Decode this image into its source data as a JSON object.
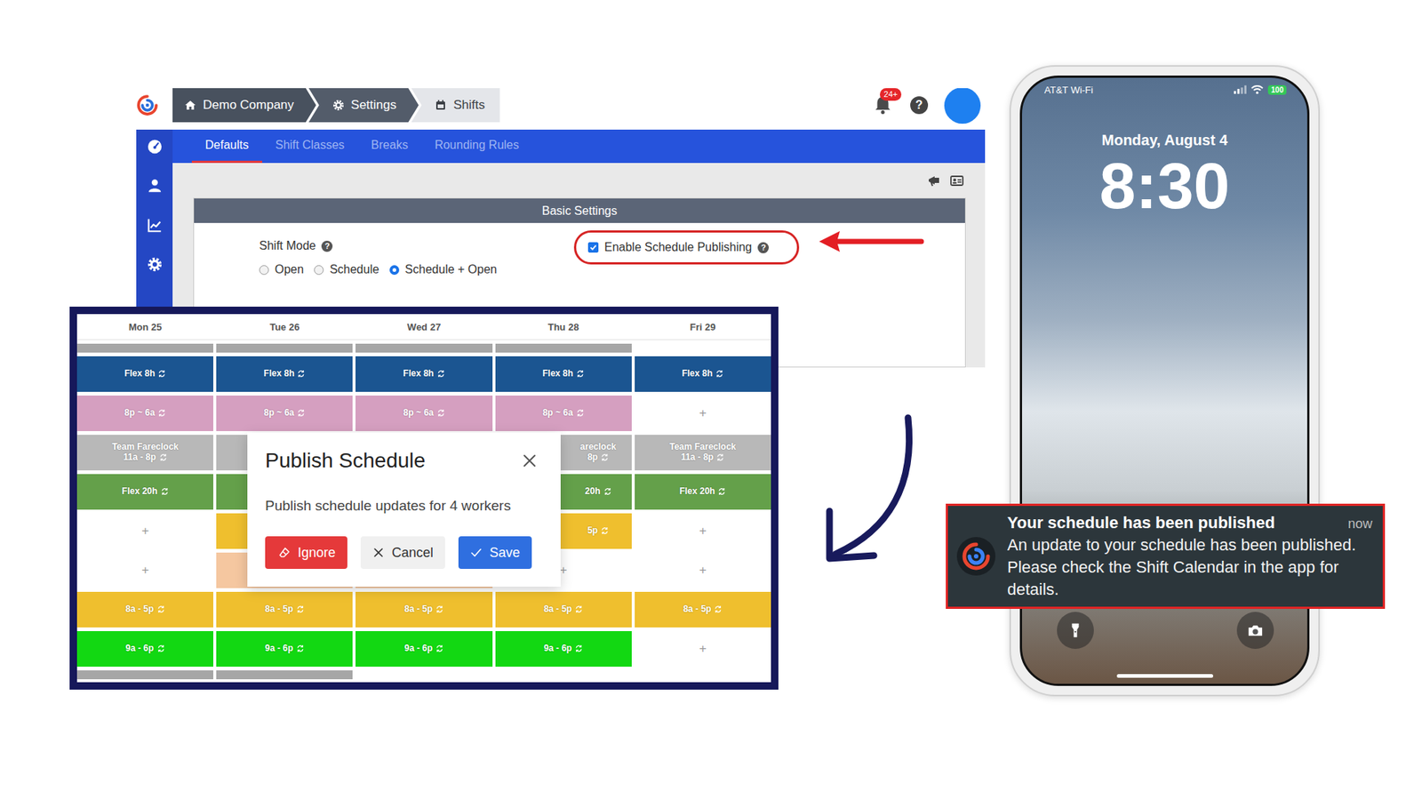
{
  "settingsWindow": {
    "breadcrumb": [
      {
        "label": "Demo Company",
        "selected": false
      },
      {
        "label": "Settings",
        "selected": false
      },
      {
        "label": "Shifts",
        "selected": true
      }
    ],
    "notificationBadge": "24+",
    "helpButton": "?",
    "tabs": [
      {
        "label": "Defaults",
        "selected": true
      },
      {
        "label": "Shift Classes",
        "selected": false
      },
      {
        "label": "Breaks",
        "selected": false
      },
      {
        "label": "Rounding Rules",
        "selected": false
      }
    ],
    "section": {
      "title": "Basic Settings",
      "shiftMode": {
        "label": "Shift Mode",
        "help": "?",
        "options": [
          {
            "label": "Open",
            "selected": false
          },
          {
            "label": "Schedule",
            "selected": false
          },
          {
            "label": "Schedule + Open",
            "selected": true
          }
        ]
      },
      "schedulePublishing": {
        "label": "Enable Schedule Publishing",
        "help": "?",
        "checked": true,
        "highlighted": true
      }
    }
  },
  "schedule": {
    "days": [
      "Mon 25",
      "Tue 26",
      "Wed 27",
      "Thu 28",
      "Fri 29"
    ],
    "rows": [
      {
        "kind": "strip",
        "cells": [
          {
            "kind": "strip",
            "color": "#a6a6a6"
          },
          {
            "kind": "strip",
            "color": "#a6a6a6"
          },
          {
            "kind": "strip",
            "color": "#a6a6a6"
          },
          {
            "kind": "strip",
            "color": "#a6a6a6"
          },
          {
            "kind": "blank"
          }
        ]
      },
      {
        "kind": "shifts",
        "cells": [
          {
            "kind": "shift",
            "lines": [
              "Flex 8h"
            ],
            "color": "#1b5591",
            "repeat": true,
            "partial": false
          },
          {
            "kind": "shift",
            "lines": [
              "Flex 8h"
            ],
            "color": "#1b5591",
            "repeat": true,
            "partial": false
          },
          {
            "kind": "shift",
            "lines": [
              "Flex 8h"
            ],
            "color": "#1b5591",
            "repeat": true,
            "partial": false
          },
          {
            "kind": "shift",
            "lines": [
              "Flex 8h"
            ],
            "color": "#1b5591",
            "repeat": true,
            "partial": false
          },
          {
            "kind": "shift",
            "lines": [
              "Flex 8h"
            ],
            "color": "#1b5591",
            "repeat": true,
            "partial": false
          }
        ]
      },
      {
        "kind": "shifts",
        "cells": [
          {
            "kind": "shift",
            "lines": [
              "8p ~ 6a"
            ],
            "color": "#d59fc0",
            "repeat": true,
            "partial": false
          },
          {
            "kind": "shift",
            "lines": [
              "8p ~ 6a"
            ],
            "color": "#d59fc0",
            "repeat": true,
            "partial": false
          },
          {
            "kind": "shift",
            "lines": [
              "8p ~ 6a"
            ],
            "color": "#d59fc0",
            "repeat": true,
            "partial": false
          },
          {
            "kind": "shift",
            "lines": [
              "8p ~ 6a"
            ],
            "color": "#d59fc0",
            "repeat": true,
            "partial": false
          },
          {
            "kind": "add",
            "label": "+"
          }
        ]
      },
      {
        "kind": "shifts",
        "cells": [
          {
            "kind": "shift",
            "lines": [
              "Team Fareclock",
              "11a - 8p"
            ],
            "color": "#b8b8b8",
            "repeat": true,
            "partial": false
          },
          {
            "kind": "shift",
            "lines": [],
            "color": "#b8b8b8",
            "repeat": false,
            "partial": false
          },
          {
            "kind": "shift",
            "lines": [],
            "color": "#b8b8b8",
            "repeat": false,
            "partial": false
          },
          {
            "kind": "shift",
            "lines": [
              "areclock",
              "8p"
            ],
            "color": "#b8b8b8",
            "repeat": true,
            "partial": true
          },
          {
            "kind": "shift",
            "lines": [
              "Team Fareclock",
              "11a - 8p"
            ],
            "color": "#b8b8b8",
            "repeat": true,
            "partial": false
          }
        ]
      },
      {
        "kind": "shifts",
        "cells": [
          {
            "kind": "shift",
            "lines": [
              "Flex 20h"
            ],
            "color": "#64a04a",
            "repeat": true,
            "partial": false
          },
          {
            "kind": "shift",
            "lines": [],
            "color": "#64a04a",
            "repeat": false,
            "partial": false
          },
          {
            "kind": "shift",
            "lines": [],
            "color": "#64a04a",
            "repeat": false,
            "partial": false
          },
          {
            "kind": "shift",
            "lines": [
              "20h"
            ],
            "color": "#64a04a",
            "repeat": true,
            "partial": true
          },
          {
            "kind": "shift",
            "lines": [
              "Flex 20h"
            ],
            "color": "#64a04a",
            "repeat": true,
            "partial": false
          }
        ]
      },
      {
        "kind": "shifts",
        "cells": [
          {
            "kind": "add",
            "label": "+"
          },
          {
            "kind": "shift",
            "lines": [],
            "color": "#efbf2e",
            "repeat": false,
            "partial": false
          },
          {
            "kind": "blank"
          },
          {
            "kind": "shift",
            "lines": [
              "5p"
            ],
            "color": "#efbf2e",
            "repeat": true,
            "partial": true
          },
          {
            "kind": "add",
            "label": "+"
          }
        ]
      },
      {
        "kind": "shifts",
        "cells": [
          {
            "kind": "add",
            "label": "+"
          },
          {
            "kind": "shift",
            "lines": [],
            "color": "#f5c7a0",
            "repeat": false,
            "partial": false
          },
          {
            "kind": "shift",
            "lines": [],
            "color": "#f5c7a0",
            "repeat": false,
            "partial": false
          },
          {
            "kind": "add",
            "label": "+"
          },
          {
            "kind": "add",
            "label": "+"
          }
        ]
      },
      {
        "kind": "shifts",
        "cells": [
          {
            "kind": "shift",
            "lines": [
              "8a - 5p"
            ],
            "color": "#efbf2e",
            "repeat": true,
            "partial": false
          },
          {
            "kind": "shift",
            "lines": [
              "8a - 5p"
            ],
            "color": "#efbf2e",
            "repeat": true,
            "partial": false
          },
          {
            "kind": "shift",
            "lines": [
              "8a - 5p"
            ],
            "color": "#efbf2e",
            "repeat": true,
            "partial": false
          },
          {
            "kind": "shift",
            "lines": [
              "8a - 5p"
            ],
            "color": "#efbf2e",
            "repeat": true,
            "partial": false
          },
          {
            "kind": "shift",
            "lines": [
              "8a - 5p"
            ],
            "color": "#efbf2e",
            "repeat": true,
            "partial": false
          }
        ]
      },
      {
        "kind": "shifts",
        "cells": [
          {
            "kind": "shift",
            "lines": [
              "9a - 6p"
            ],
            "color": "#12d812",
            "repeat": true,
            "partial": false
          },
          {
            "kind": "shift",
            "lines": [
              "9a - 6p"
            ],
            "color": "#12d812",
            "repeat": true,
            "partial": false
          },
          {
            "kind": "shift",
            "lines": [
              "9a - 6p"
            ],
            "color": "#12d812",
            "repeat": true,
            "partial": false
          },
          {
            "kind": "shift",
            "lines": [
              "9a - 6p"
            ],
            "color": "#12d812",
            "repeat": true,
            "partial": false
          },
          {
            "kind": "add",
            "label": "+"
          }
        ]
      },
      {
        "kind": "strip",
        "cells": [
          {
            "kind": "strip",
            "color": "#a6a6a6"
          },
          {
            "kind": "strip",
            "color": "#a6a6a6"
          },
          {
            "kind": "blank"
          },
          {
            "kind": "blank"
          },
          {
            "kind": "blank"
          }
        ]
      }
    ]
  },
  "publishDialog": {
    "title": "Publish Schedule",
    "message": "Publish schedule updates for 4 workers",
    "buttons": [
      {
        "label": "Ignore",
        "kind": "danger"
      },
      {
        "label": "Cancel",
        "kind": "secondary"
      },
      {
        "label": "Save",
        "kind": "primary"
      }
    ]
  },
  "phone": {
    "carrier": "AT&T Wi-Fi",
    "battery": "100",
    "date": "Monday, August 4",
    "time": "8:30",
    "notification": {
      "title": "Your schedule has been published",
      "time": "now",
      "body": "An update to your schedule has been published. Please check the Shift Calendar in the app for details."
    }
  }
}
